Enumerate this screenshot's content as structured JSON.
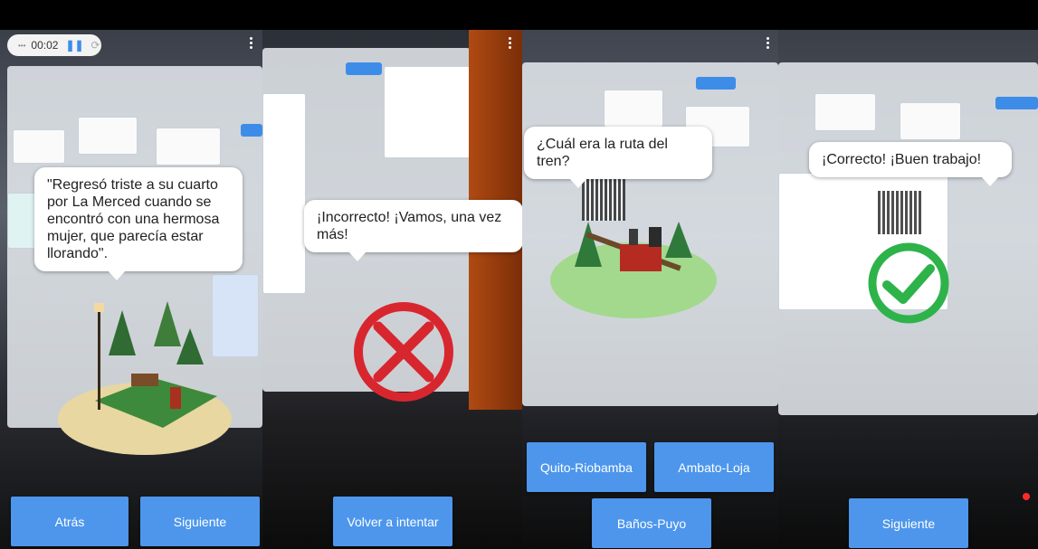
{
  "recorder": {
    "time": "00:02"
  },
  "panel1": {
    "bubble_text": "\"Regresó triste a su cuarto por La Merced cuando se encontró con una hermosa mujer, que parecía estar llorando\".",
    "buttons": {
      "back": "Atrás",
      "next": "Siguiente"
    }
  },
  "panel2": {
    "bubble_text": "¡Incorrecto! ¡Vamos, una vez más!",
    "buttons": {
      "retry": "Volver a intentar"
    }
  },
  "panel3": {
    "bubble_text": "¿Cuál era la ruta del tren?",
    "buttons": {
      "option1": "Quito-Riobamba",
      "option2": "Ambato-Loja",
      "option3": "Baños-Puyo"
    }
  },
  "panel4": {
    "bubble_text": "¡Correcto! ¡Buen trabajo!",
    "buttons": {
      "next": "Siguiente"
    }
  },
  "colors": {
    "button": "#4d96ec",
    "wrong": "#d8262f",
    "correct": "#2db34a"
  }
}
